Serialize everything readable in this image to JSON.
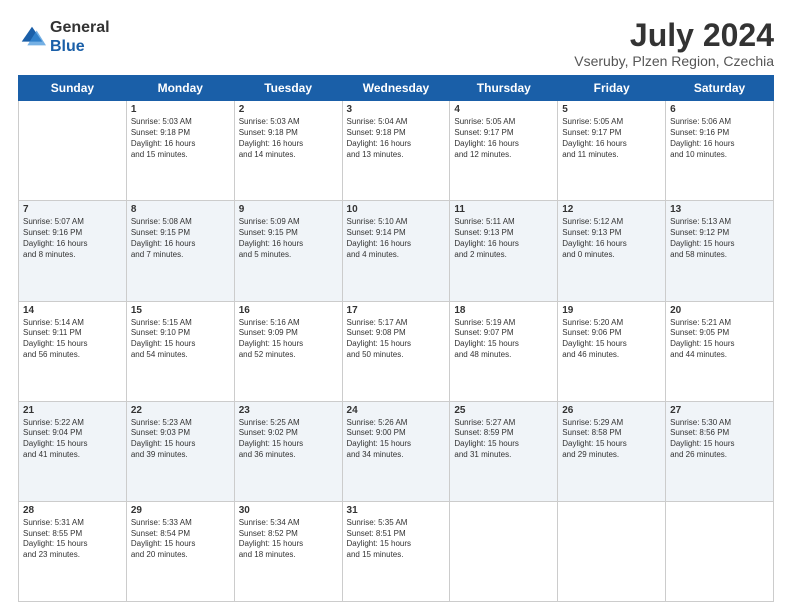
{
  "logo": {
    "general": "General",
    "blue": "Blue"
  },
  "header": {
    "month_year": "July 2024",
    "location": "Vseruby, Plzen Region, Czechia"
  },
  "days_of_week": [
    "Sunday",
    "Monday",
    "Tuesday",
    "Wednesday",
    "Thursday",
    "Friday",
    "Saturday"
  ],
  "weeks": [
    [
      {
        "day": "",
        "info": ""
      },
      {
        "day": "1",
        "info": "Sunrise: 5:03 AM\nSunset: 9:18 PM\nDaylight: 16 hours\nand 15 minutes."
      },
      {
        "day": "2",
        "info": "Sunrise: 5:03 AM\nSunset: 9:18 PM\nDaylight: 16 hours\nand 14 minutes."
      },
      {
        "day": "3",
        "info": "Sunrise: 5:04 AM\nSunset: 9:18 PM\nDaylight: 16 hours\nand 13 minutes."
      },
      {
        "day": "4",
        "info": "Sunrise: 5:05 AM\nSunset: 9:17 PM\nDaylight: 16 hours\nand 12 minutes."
      },
      {
        "day": "5",
        "info": "Sunrise: 5:05 AM\nSunset: 9:17 PM\nDaylight: 16 hours\nand 11 minutes."
      },
      {
        "day": "6",
        "info": "Sunrise: 5:06 AM\nSunset: 9:16 PM\nDaylight: 16 hours\nand 10 minutes."
      }
    ],
    [
      {
        "day": "7",
        "info": "Sunrise: 5:07 AM\nSunset: 9:16 PM\nDaylight: 16 hours\nand 8 minutes."
      },
      {
        "day": "8",
        "info": "Sunrise: 5:08 AM\nSunset: 9:15 PM\nDaylight: 16 hours\nand 7 minutes."
      },
      {
        "day": "9",
        "info": "Sunrise: 5:09 AM\nSunset: 9:15 PM\nDaylight: 16 hours\nand 5 minutes."
      },
      {
        "day": "10",
        "info": "Sunrise: 5:10 AM\nSunset: 9:14 PM\nDaylight: 16 hours\nand 4 minutes."
      },
      {
        "day": "11",
        "info": "Sunrise: 5:11 AM\nSunset: 9:13 PM\nDaylight: 16 hours\nand 2 minutes."
      },
      {
        "day": "12",
        "info": "Sunrise: 5:12 AM\nSunset: 9:13 PM\nDaylight: 16 hours\nand 0 minutes."
      },
      {
        "day": "13",
        "info": "Sunrise: 5:13 AM\nSunset: 9:12 PM\nDaylight: 15 hours\nand 58 minutes."
      }
    ],
    [
      {
        "day": "14",
        "info": "Sunrise: 5:14 AM\nSunset: 9:11 PM\nDaylight: 15 hours\nand 56 minutes."
      },
      {
        "day": "15",
        "info": "Sunrise: 5:15 AM\nSunset: 9:10 PM\nDaylight: 15 hours\nand 54 minutes."
      },
      {
        "day": "16",
        "info": "Sunrise: 5:16 AM\nSunset: 9:09 PM\nDaylight: 15 hours\nand 52 minutes."
      },
      {
        "day": "17",
        "info": "Sunrise: 5:17 AM\nSunset: 9:08 PM\nDaylight: 15 hours\nand 50 minutes."
      },
      {
        "day": "18",
        "info": "Sunrise: 5:19 AM\nSunset: 9:07 PM\nDaylight: 15 hours\nand 48 minutes."
      },
      {
        "day": "19",
        "info": "Sunrise: 5:20 AM\nSunset: 9:06 PM\nDaylight: 15 hours\nand 46 minutes."
      },
      {
        "day": "20",
        "info": "Sunrise: 5:21 AM\nSunset: 9:05 PM\nDaylight: 15 hours\nand 44 minutes."
      }
    ],
    [
      {
        "day": "21",
        "info": "Sunrise: 5:22 AM\nSunset: 9:04 PM\nDaylight: 15 hours\nand 41 minutes."
      },
      {
        "day": "22",
        "info": "Sunrise: 5:23 AM\nSunset: 9:03 PM\nDaylight: 15 hours\nand 39 minutes."
      },
      {
        "day": "23",
        "info": "Sunrise: 5:25 AM\nSunset: 9:02 PM\nDaylight: 15 hours\nand 36 minutes."
      },
      {
        "day": "24",
        "info": "Sunrise: 5:26 AM\nSunset: 9:00 PM\nDaylight: 15 hours\nand 34 minutes."
      },
      {
        "day": "25",
        "info": "Sunrise: 5:27 AM\nSunset: 8:59 PM\nDaylight: 15 hours\nand 31 minutes."
      },
      {
        "day": "26",
        "info": "Sunrise: 5:29 AM\nSunset: 8:58 PM\nDaylight: 15 hours\nand 29 minutes."
      },
      {
        "day": "27",
        "info": "Sunrise: 5:30 AM\nSunset: 8:56 PM\nDaylight: 15 hours\nand 26 minutes."
      }
    ],
    [
      {
        "day": "28",
        "info": "Sunrise: 5:31 AM\nSunset: 8:55 PM\nDaylight: 15 hours\nand 23 minutes."
      },
      {
        "day": "29",
        "info": "Sunrise: 5:33 AM\nSunset: 8:54 PM\nDaylight: 15 hours\nand 20 minutes."
      },
      {
        "day": "30",
        "info": "Sunrise: 5:34 AM\nSunset: 8:52 PM\nDaylight: 15 hours\nand 18 minutes."
      },
      {
        "day": "31",
        "info": "Sunrise: 5:35 AM\nSunset: 8:51 PM\nDaylight: 15 hours\nand 15 minutes."
      },
      {
        "day": "",
        "info": ""
      },
      {
        "day": "",
        "info": ""
      },
      {
        "day": "",
        "info": ""
      }
    ]
  ]
}
